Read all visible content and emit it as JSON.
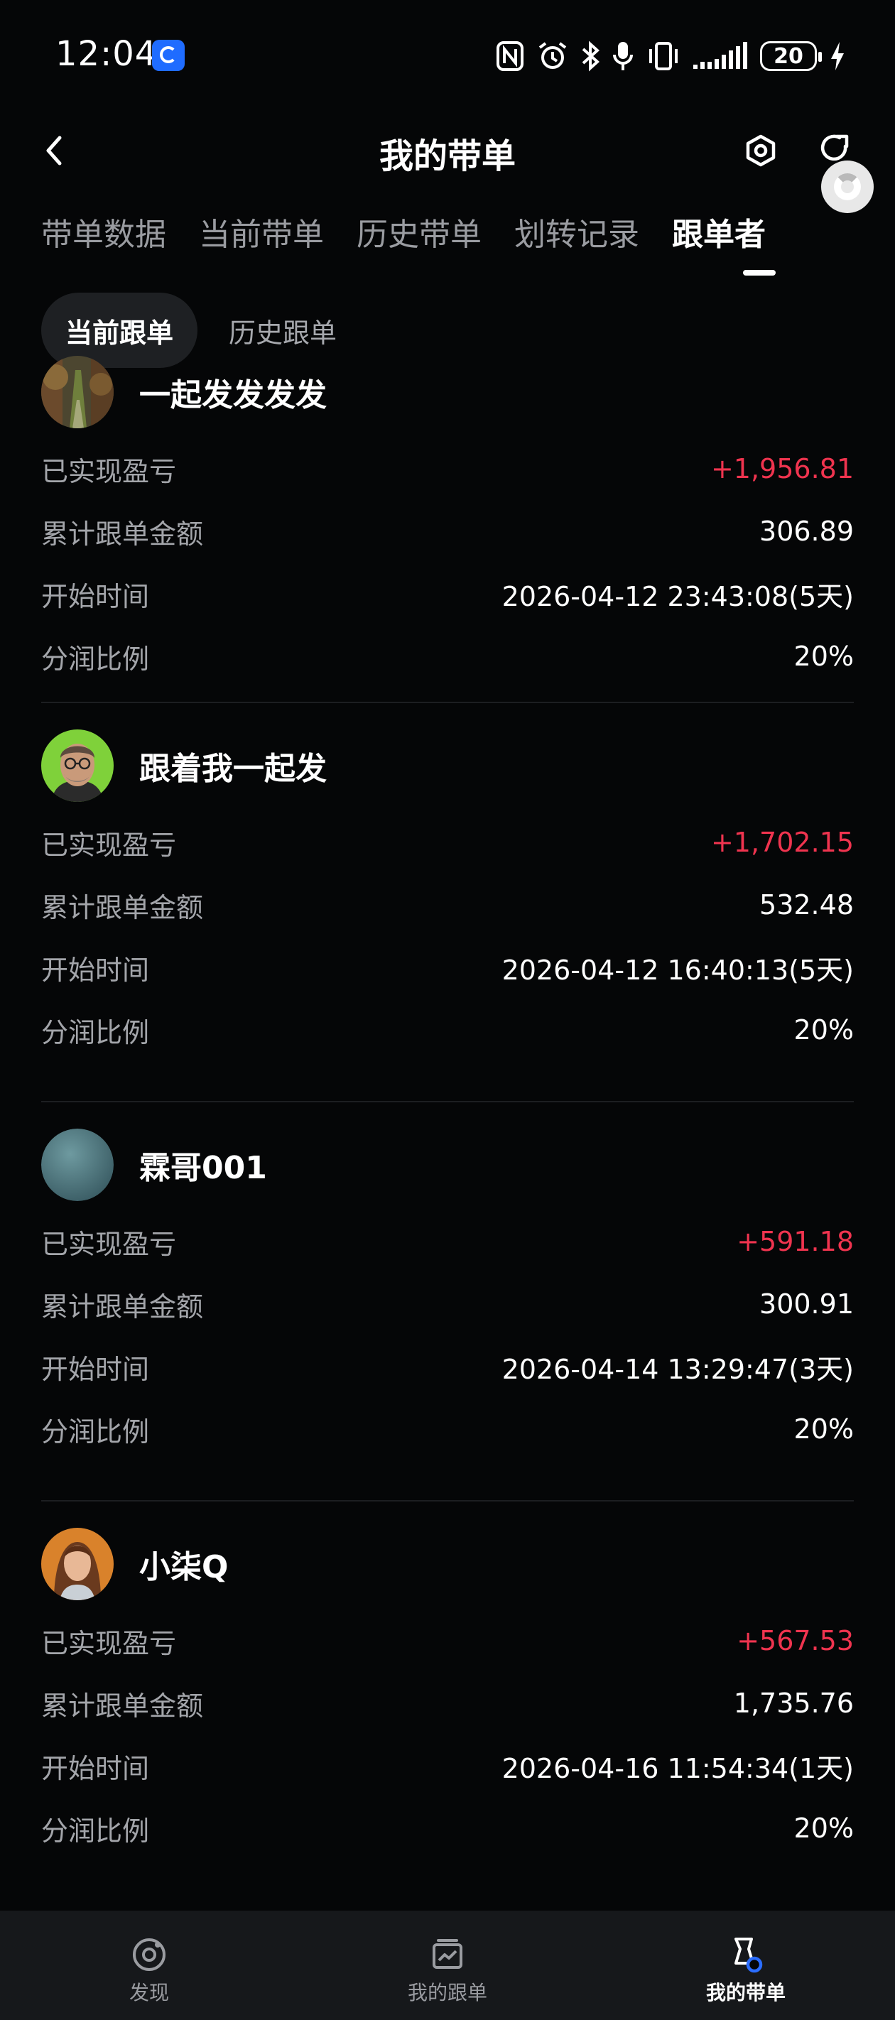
{
  "status_bar": {
    "time": "12:04",
    "battery": "20"
  },
  "header": {
    "title": "我的带单"
  },
  "tabs": [
    {
      "label": "带单数据"
    },
    {
      "label": "当前带单"
    },
    {
      "label": "历史带单"
    },
    {
      "label": "划转记录"
    },
    {
      "label": "跟单者",
      "active": true
    }
  ],
  "subtabs": [
    {
      "label": "当前跟单",
      "active": true
    },
    {
      "label": "历史跟单"
    }
  ],
  "row_labels": {
    "pnl": "已实现盈亏",
    "amount": "累计跟单金额",
    "start": "开始时间",
    "share": "分润比例"
  },
  "followers": [
    {
      "name": "一起发发发发",
      "pnl": "+1,956.81",
      "amount": "306.89",
      "start": "2026-04-12 23:43:08(5天)",
      "share": "20%",
      "avatar": "forest-avatar"
    },
    {
      "name": "跟着我一起发",
      "pnl": "+1,702.15",
      "amount": "532.48",
      "start": "2026-04-12 16:40:13(5天)",
      "share": "20%",
      "avatar": "man-glasses-avatar"
    },
    {
      "name": "霖哥001",
      "pnl": "+591.18",
      "amount": "300.91",
      "start": "2026-04-14 13:29:47(3天)",
      "share": "20%",
      "avatar": "teal-sphere-avatar"
    },
    {
      "name": "小柒Q",
      "pnl": "+567.53",
      "amount": "1,735.76",
      "start": "2026-04-16 11:54:34(1天)",
      "share": "20%",
      "avatar": "woman-avatar"
    }
  ],
  "bottom_nav": [
    {
      "label": "发现",
      "icon": "discover-icon"
    },
    {
      "label": "我的跟单",
      "icon": "my-copy-icon"
    },
    {
      "label": "我的带单",
      "icon": "my-lead-icon",
      "active": true
    }
  ],
  "colors": {
    "positive": "#f0344f",
    "background": "#050607"
  }
}
